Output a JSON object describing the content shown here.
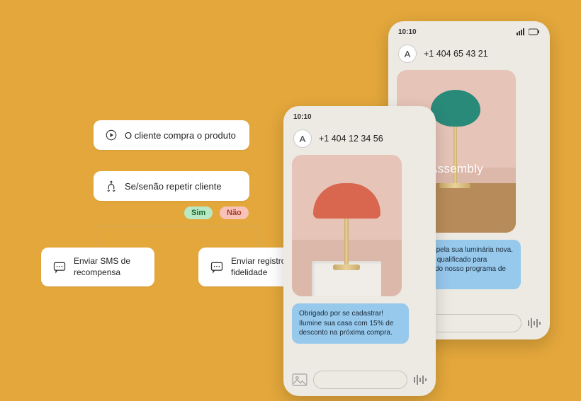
{
  "flow": {
    "trigger": "O cliente compra o produto",
    "condition": "Se/senão repetir cliente",
    "yes_label": "Sim",
    "no_label": "Não",
    "action_sms": "Enviar SMS de recompensa",
    "action_register": "Enviar registro de fidelidade"
  },
  "phone_back": {
    "time": "10:10",
    "avatar_initial": "A",
    "number": "+1 404 65 43 21",
    "image_overlay": "Assembly",
    "message": "Parabéns pela sua luminária nova. Você está qualificado para participar do nosso programa de fidelidade!"
  },
  "phone_front": {
    "time": "10:10",
    "avatar_initial": "A",
    "number": "+1 404 12 34 56",
    "message": "Obrigado por se cadastrar! Ilumine sua casa com 15% de desconto na próxima compra."
  }
}
